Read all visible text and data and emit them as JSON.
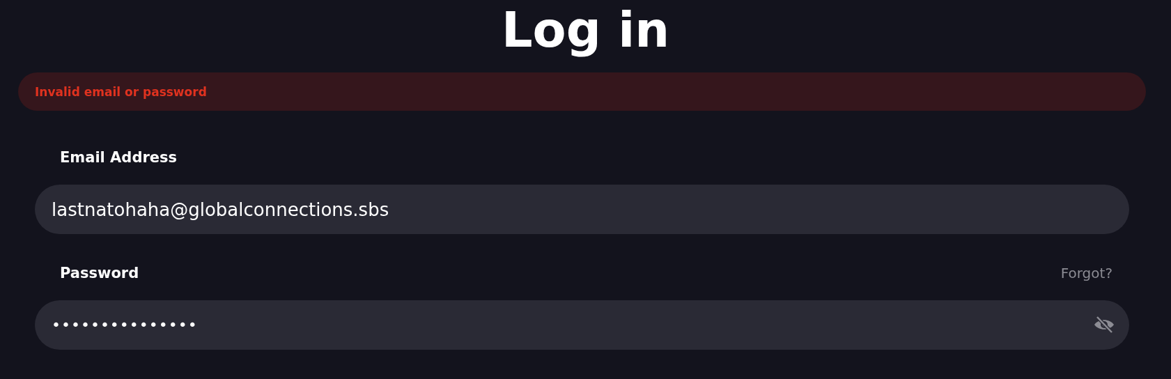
{
  "title": "Log in",
  "error": "Invalid email or password",
  "email": {
    "label": "Email Address",
    "value": "lastnatohaha@globalconnections.sbs"
  },
  "password": {
    "label": "Password",
    "forgot_link": "Forgot?",
    "value": "•••••••••••••••"
  }
}
